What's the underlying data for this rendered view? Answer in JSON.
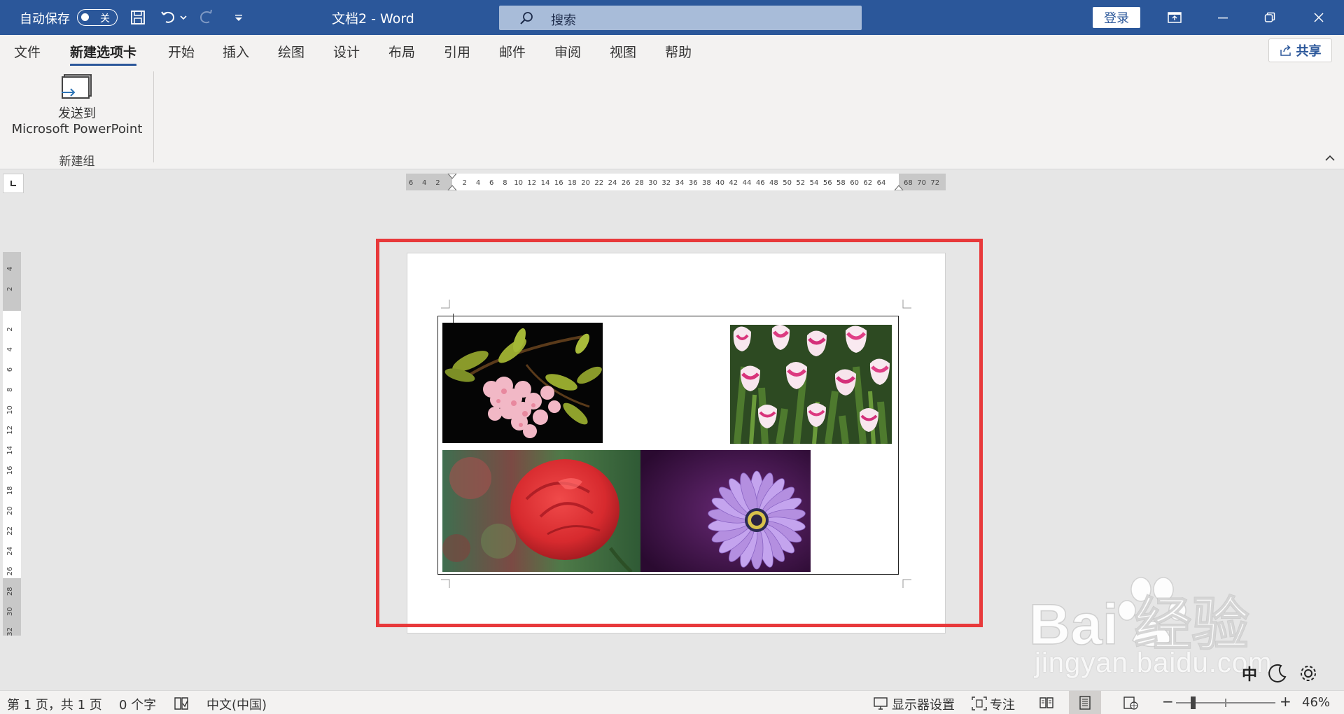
{
  "titlebar": {
    "autosave_label": "自动保存",
    "autosave_state": "关",
    "document_title": "文档2  -  Word",
    "search_placeholder": "搜索",
    "login_label": "登录"
  },
  "tabs": [
    {
      "label": "文件",
      "active": false
    },
    {
      "label": "新建选项卡",
      "active": true
    },
    {
      "label": "开始",
      "active": false
    },
    {
      "label": "插入",
      "active": false
    },
    {
      "label": "绘图",
      "active": false
    },
    {
      "label": "设计",
      "active": false
    },
    {
      "label": "布局",
      "active": false
    },
    {
      "label": "引用",
      "active": false
    },
    {
      "label": "邮件",
      "active": false
    },
    {
      "label": "审阅",
      "active": false
    },
    {
      "label": "视图",
      "active": false
    },
    {
      "label": "帮助",
      "active": false
    }
  ],
  "share_label": "共享",
  "ribbon": {
    "send_button_line1": "发送到",
    "send_button_line2": "Microsoft PowerPoint",
    "group_label": "新建组"
  },
  "h_ruler_labels": [
    "6",
    "4",
    "2",
    "",
    "2",
    "4",
    "6",
    "8",
    "10",
    "12",
    "14",
    "16",
    "18",
    "20",
    "22",
    "24",
    "26",
    "28",
    "30",
    "32",
    "34",
    "36",
    "38",
    "40",
    "42",
    "44",
    "46",
    "48",
    "50",
    "52",
    "54",
    "56",
    "58",
    "60",
    "62",
    "64",
    "",
    "68",
    "70",
    "72"
  ],
  "v_ruler_labels": [
    "4",
    "2",
    "",
    "2",
    "4",
    "6",
    "8",
    "10",
    "12",
    "14",
    "16",
    "18",
    "20",
    "22",
    "24",
    "26",
    "28",
    "30",
    "32"
  ],
  "document": {
    "photos": [
      "cherry-blossom",
      "pink-tulips",
      "red-rose",
      "purple-daisy"
    ]
  },
  "statusbar": {
    "page_info": "第 1 页，共 1 页",
    "word_count": "0 个字",
    "language": "中文(中国)",
    "display_settings": "显示器设置",
    "focus": "专注",
    "zoom_level": "46%"
  },
  "watermark": {
    "brand": "Bai 经验",
    "url": "jingyan.baidu.com"
  },
  "ime": {
    "mode": "中"
  },
  "colors": {
    "titlebar": "#2b579a",
    "highlight": "#e8393b",
    "ribbon": "#f3f2f1"
  }
}
